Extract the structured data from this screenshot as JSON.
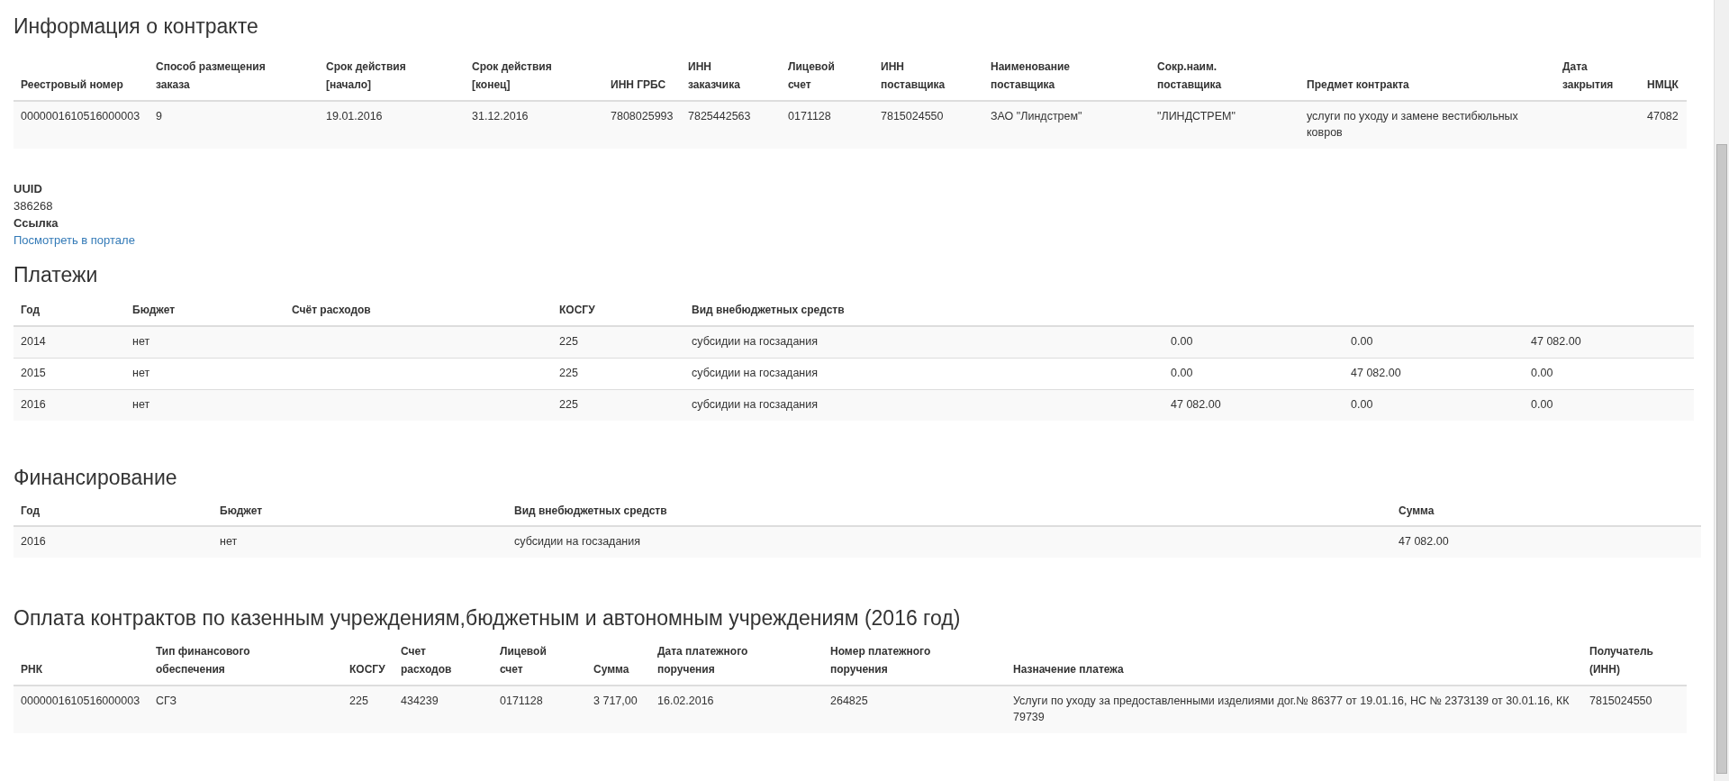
{
  "contract": {
    "title": "Информация о контракте",
    "columns": [
      "Реестровый номер",
      "Способ размещения\nзаказа",
      "Срок действия\n[начало]",
      "Срок действия\n[конец]",
      "ИНН ГРБС",
      "ИНН\nзаказчика",
      "Лицевой\nсчет",
      "ИНН\nпоставщика",
      "Наименование\nпоставщика",
      "Сокр.наим.\nпоставщика",
      "Предмет контракта",
      "Дата\nзакрытия",
      "НМЦК"
    ],
    "rows": [
      [
        "0000001610516000003",
        "9",
        "19.01.2016",
        "31.12.2016",
        "7808025993",
        "7825442563",
        "0171128",
        "7815024550",
        "ЗАО \"Линдстрем\"",
        "\"ЛИНДСТРЕМ\"",
        "услуги по уходу и замене вестибюльных ковров",
        null,
        "47082"
      ]
    ]
  },
  "details": [
    {
      "label": "UUID",
      "value": "386268",
      "kind": "text"
    },
    {
      "label": "Ссылка",
      "value": "Посмотреть в портале",
      "kind": "link"
    }
  ],
  "payments": {
    "title": "Платежи",
    "columns": [
      "Год",
      "Бюджет",
      "Счёт расходов",
      "КОСГУ",
      "Вид внебюджетных средств"
    ],
    "rows": [
      [
        "2014",
        "нет",
        null,
        "225",
        "субсидии на госзадания",
        "0.00",
        "0.00",
        "47 082.00"
      ],
      [
        "2015",
        "нет",
        null,
        "225",
        "субсидии на госзадания",
        "0.00",
        "47 082.00",
        "0.00"
      ],
      [
        "2016",
        "нет",
        null,
        "225",
        "субсидии на госзадания",
        "47 082.00",
        "0.00",
        "0.00"
      ]
    ]
  },
  "financing": {
    "title": "Финансирование",
    "columns": [
      "Год",
      "Бюджет",
      "Вид внебюджетных средств",
      "Сумма"
    ],
    "rows": [
      [
        "2016",
        "нет",
        "субсидии на госзадания",
        "47 082.00"
      ]
    ]
  },
  "contract_payments": {
    "title": "Оплата контрактов по казенным учреждениям,бюджетным и автономным учреждениям (2016 год)",
    "columns": [
      "РНК",
      "Тип финансового\nобеспечения",
      "КОСГУ",
      "Счет\nрасходов",
      "Лицевой\nсчет",
      "Сумма",
      "Дата платежного\nпоручения",
      "Номер платежного\nпоручения",
      "Назначение платежа",
      "Получатель\n(ИНН)"
    ],
    "rows": [
      [
        "0000001610516000003",
        "СГЗ",
        "225",
        "434239",
        "0171128",
        "3 717,00",
        "16.02.2016",
        "264825",
        "Услуги по уходу за предоставленными изделиями дог.№ 86377 от 19.01.16, НС № 2373139 от 30.01.16, КК 79739",
        "7815024550"
      ]
    ]
  }
}
